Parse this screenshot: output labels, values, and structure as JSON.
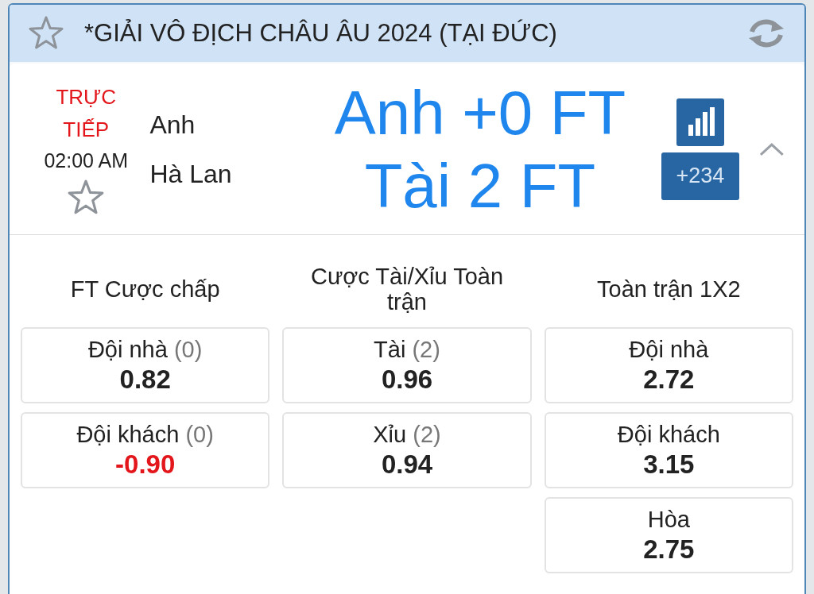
{
  "league": {
    "title": "*GIẢI VÔ ĐỊCH CHÂU ÂU 2024 (TẠI ĐỨC)",
    "favorite": false
  },
  "match": {
    "status": "TRỰC TIẾP",
    "time": "02:00 AM",
    "favorite": false,
    "home": "Anh",
    "away": "Hà Lan",
    "headline": [
      "Anh +0 FT",
      "Tài 2 FT"
    ],
    "more_markets": "+234",
    "expanded": true
  },
  "markets": [
    {
      "title": "FT Cược chấp",
      "options": [
        {
          "label": "Đội nhà",
          "line": "(0)",
          "odds": "0.82",
          "negative": false
        },
        {
          "label": "Đội khách",
          "line": "(0)",
          "odds": "-0.90",
          "negative": true
        }
      ]
    },
    {
      "title": "Cược Tài/Xỉu Toàn trận",
      "options": [
        {
          "label": "Tài",
          "line": "(2)",
          "odds": "0.96",
          "negative": false
        },
        {
          "label": "Xỉu",
          "line": "(2)",
          "odds": "0.94",
          "negative": false
        }
      ]
    },
    {
      "title": "Toàn trận 1X2",
      "options": [
        {
          "label": "Đội nhà",
          "odds": "2.72",
          "negative": false
        },
        {
          "label": "Đội khách",
          "odds": "3.15",
          "negative": false
        },
        {
          "label": "Hòa",
          "odds": "2.75",
          "negative": false
        }
      ]
    }
  ]
}
